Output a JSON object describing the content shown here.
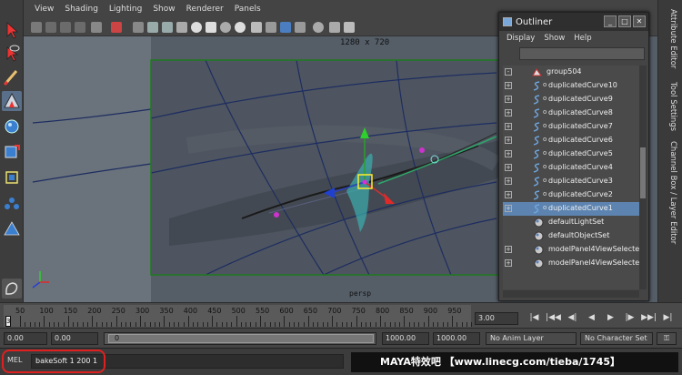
{
  "viewport": {
    "menus": [
      "View",
      "Shading",
      "Lighting",
      "Show",
      "Renderer",
      "Panels"
    ],
    "resolution": "1280 x 720",
    "camera": "persp"
  },
  "outliner": {
    "title": "Outliner",
    "menus": [
      "Display",
      "Show",
      "Help"
    ],
    "items": [
      {
        "label": "group504",
        "expand": "-",
        "type": "group-icon"
      },
      {
        "label": "duplicatedCurve10",
        "expand": "+",
        "type": "curve-icon"
      },
      {
        "label": "duplicatedCurve9",
        "expand": "+",
        "type": "curve-icon"
      },
      {
        "label": "duplicatedCurve8",
        "expand": "+",
        "type": "curve-icon"
      },
      {
        "label": "duplicatedCurve7",
        "expand": "+",
        "type": "curve-icon"
      },
      {
        "label": "duplicatedCurve6",
        "expand": "+",
        "type": "curve-icon"
      },
      {
        "label": "duplicatedCurve5",
        "expand": "+",
        "type": "curve-icon"
      },
      {
        "label": "duplicatedCurve4",
        "expand": "+",
        "type": "curve-icon"
      },
      {
        "label": "duplicatedCurve3",
        "expand": "+",
        "type": "curve-icon"
      },
      {
        "label": "duplicatedCurve2",
        "expand": "+",
        "type": "curve-icon"
      },
      {
        "label": "duplicatedCurve1",
        "expand": "+",
        "type": "curve-icon",
        "selected": true
      },
      {
        "label": "defaultLightSet",
        "expand": "",
        "type": "set-icon"
      },
      {
        "label": "defaultObjectSet",
        "expand": "",
        "type": "set-icon"
      },
      {
        "label": "modelPanel4ViewSelecte",
        "expand": "+",
        "type": "set-icon"
      },
      {
        "label": "modelPanel4ViewSelecte",
        "expand": "+",
        "type": "set-icon"
      }
    ]
  },
  "side_tabs": [
    "Attribute Editor",
    "Tool Settings",
    "Channel Box / Layer Editor"
  ],
  "timeline": {
    "ticks": [
      "50",
      "100",
      "150",
      "200",
      "250",
      "300",
      "350",
      "400",
      "450",
      "500",
      "550",
      "600",
      "650",
      "700",
      "750",
      "800",
      "850",
      "900",
      "950"
    ],
    "start_marker": "3",
    "current_frame": "3.00",
    "controls": [
      "|◀",
      "|◀◀",
      "◀|",
      "◀",
      "▶",
      "|▶",
      "▶▶|",
      "▶|"
    ]
  },
  "range": {
    "start": "0.00",
    "anim_start": "0.00",
    "slider_value": "0",
    "anim_end": "1000.00",
    "end": "1000.00",
    "anim_layer": "No Anim Layer",
    "character_set": "No Character Set"
  },
  "command": {
    "label": "MEL",
    "value": "bakeSoft 1 200 1"
  },
  "watermark": "MAYA特效吧 【www.linecg.com/tieba/1745】",
  "colors": {
    "selection": "#5d84b0",
    "highlight": "#e02020",
    "frame_border": "#1f7a1f"
  }
}
